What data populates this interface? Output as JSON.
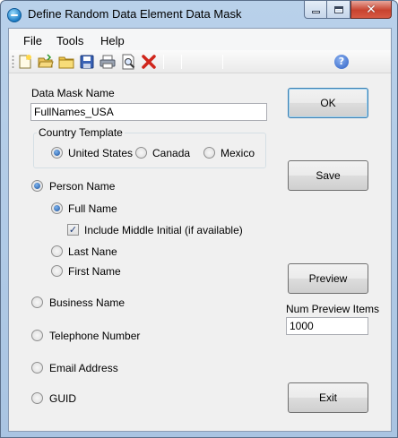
{
  "window": {
    "title": "Define Random Data Element Data Mask"
  },
  "menu": {
    "items": [
      "File",
      "Tools",
      "Help"
    ]
  },
  "toolbar": {
    "buttons": [
      "new-icon",
      "open-icon",
      "folder-icon",
      "save-icon",
      "print-icon",
      "print-preview-icon",
      "delete-icon"
    ],
    "help_label": "?"
  },
  "form": {
    "mask_name_label": "Data Mask Name",
    "mask_name_value": "FullNames_USA",
    "country_group_title": "Country Template",
    "countries": [
      {
        "label": "United States",
        "checked": true
      },
      {
        "label": "Canada",
        "checked": false
      },
      {
        "label": "Mexico",
        "checked": false
      }
    ],
    "options": {
      "person_name": {
        "label": "Person Name",
        "checked": true
      },
      "full_name": {
        "label": "Full Name",
        "checked": true
      },
      "include_middle": {
        "label": "Include Middle Initial (if available)",
        "checked": true
      },
      "last_name": {
        "label": "Last Nane",
        "checked": false
      },
      "first_name": {
        "label": "First Name",
        "checked": false
      },
      "business_name": {
        "label": "Business Name",
        "checked": false
      },
      "telephone": {
        "label": "Telephone Number",
        "checked": false
      },
      "email": {
        "label": "Email Address",
        "checked": false
      },
      "guid": {
        "label": "GUID",
        "checked": false
      }
    },
    "num_preview_label": "Num Preview Items",
    "num_preview_value": "1000"
  },
  "buttons": {
    "ok": "OK",
    "save": "Save",
    "preview": "Preview",
    "exit": "Exit"
  }
}
